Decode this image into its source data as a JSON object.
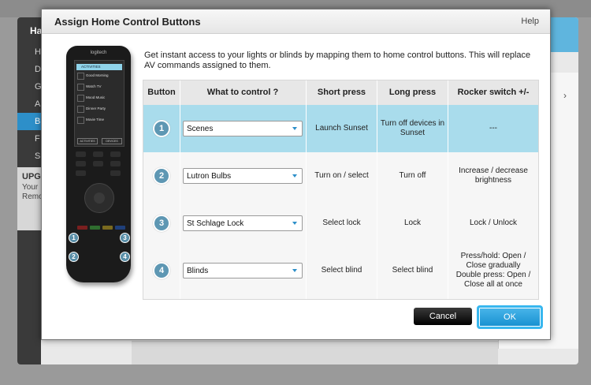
{
  "background": {
    "app_title": "Ha",
    "nav_items": [
      "H",
      "D",
      "G",
      "A",
      "B",
      "F",
      "S"
    ],
    "active_index": 4,
    "upgrade": {
      "title": "UPG",
      "line1": "Your",
      "line2": "Remo"
    },
    "chevron": "›"
  },
  "dialog": {
    "title": "Assign Home Control Buttons",
    "help": "Help",
    "intro": "Get instant access to your lights or blinds by mapping them to home control buttons. This will replace AV commands assigned to them.",
    "columns": [
      "Button",
      "What to control ?",
      "Short press",
      "Long press",
      "Rocker switch +/-"
    ],
    "rows": [
      {
        "number": "1",
        "control": "Scenes",
        "short": "Launch Sunset",
        "long": "Turn off devices in Sunset",
        "rocker": "---",
        "selected": true
      },
      {
        "number": "2",
        "control": "Lutron Bulbs",
        "short": "Turn on / select",
        "long": "Turn off",
        "rocker": "Increase / decrease brightness",
        "selected": false
      },
      {
        "number": "3",
        "control": "St Schlage Lock",
        "short": "Select lock",
        "long": "Lock",
        "rocker": "Lock / Unlock",
        "selected": false
      },
      {
        "number": "4",
        "control": "Blinds",
        "short": "Select blind",
        "long": "Select blind",
        "rocker": "Press/hold: Open / Close gradually\nDouble press: Open / Close all at once",
        "selected": false
      }
    ],
    "cancel_label": "Cancel",
    "ok_label": "OK"
  },
  "remote": {
    "brand": "logitech",
    "screen_items": [
      "ACTIVITIES",
      "Good Morning",
      "Watch TV",
      "Mood Music",
      "Dinner Party",
      "Movie Time"
    ],
    "screen_buttons": [
      "ACTIVITIES",
      "DEVICES"
    ],
    "markers": [
      "1",
      "2",
      "3",
      "4"
    ]
  },
  "colors": {
    "selected_row": "#a9dcec",
    "accent": "#2d8fc9",
    "ok_button": "#1790d0"
  }
}
